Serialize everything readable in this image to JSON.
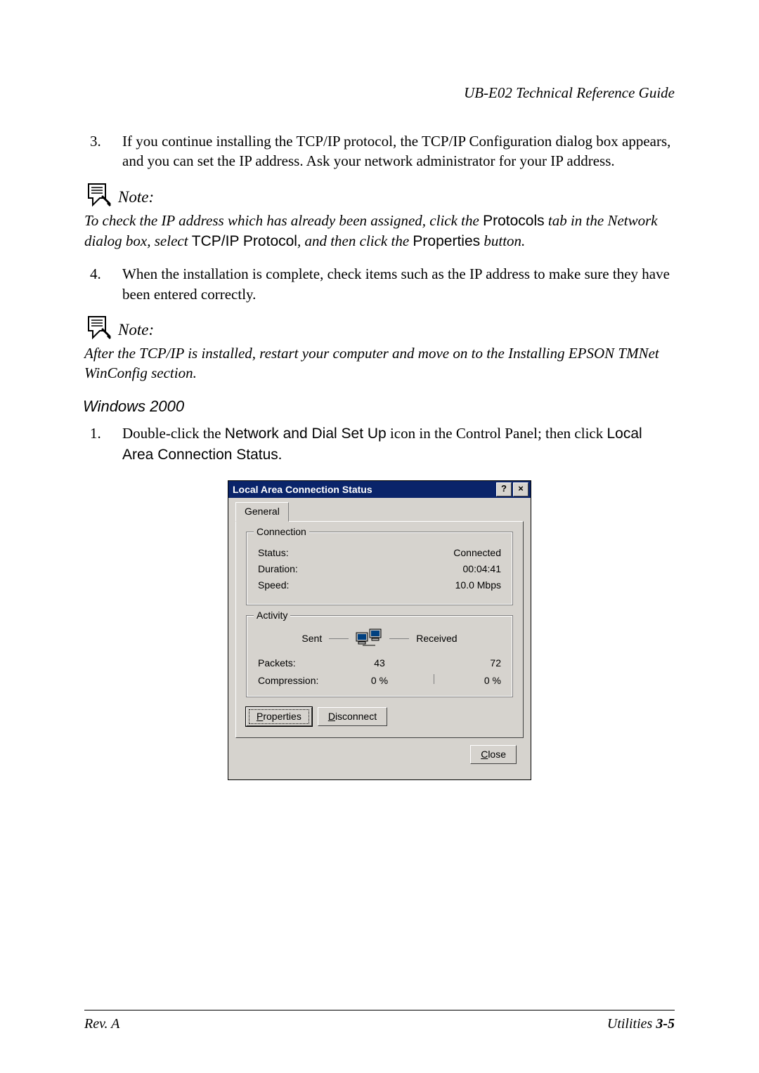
{
  "header": {
    "doc_title": "UB-E02 Technical Reference Guide"
  },
  "list": {
    "item3": {
      "marker": "3.",
      "text": "If you continue installing the TCP/IP protocol, the TCP/IP Configuration dialog box appears, and you can set the IP address. Ask your network administrator for your IP address."
    },
    "item4": {
      "marker": "4.",
      "text": "When the installation is complete, check items such as the IP address to make sure they have been entered correctly."
    },
    "item1b": {
      "marker": "1.",
      "prefix": "Double-click the ",
      "sans1": "Network and Dial Set Up",
      "mid": " icon in the Control Panel; then click ",
      "sans2": "Local Area Connection Status",
      "suffix": "."
    }
  },
  "notes": {
    "label": "Note:",
    "n1": {
      "seg1": "To check the IP address which has already been assigned, click the ",
      "sans1": "Protocols",
      "seg2": " tab in the Network dialog box, select ",
      "sans2": "TCP/IP Protocol",
      "seg3": ", and then click the ",
      "sans3": "Properties",
      "seg4": " button."
    },
    "n2": {
      "text": "After the TCP/IP is installed, restart your computer and move on to the Installing EPSON TMNet WinConfig section."
    }
  },
  "section": {
    "win2000": "Windows 2000"
  },
  "dialog": {
    "title": "Local Area Connection Status",
    "help_btn": "?",
    "close_btn": "×",
    "tab_general": "General",
    "group_connection": "Connection",
    "status_label": "Status:",
    "status_value": "Connected",
    "duration_label": "Duration:",
    "duration_value": "00:04:41",
    "speed_label": "Speed:",
    "speed_value": "10.0 Mbps",
    "group_activity": "Activity",
    "sent_label": "Sent",
    "received_label": "Received",
    "packets_label": "Packets:",
    "packets_sent": "43",
    "packets_recv": "72",
    "compression_label": "Compression:",
    "compression_sent": "0 %",
    "compression_recv": "0 %",
    "btn_properties": "Properties",
    "btn_disconnect": "Disconnect",
    "btn_close": "Close"
  },
  "footer": {
    "left": "Rev. A",
    "right_label": "Utilities",
    "right_page": "  3-5"
  }
}
